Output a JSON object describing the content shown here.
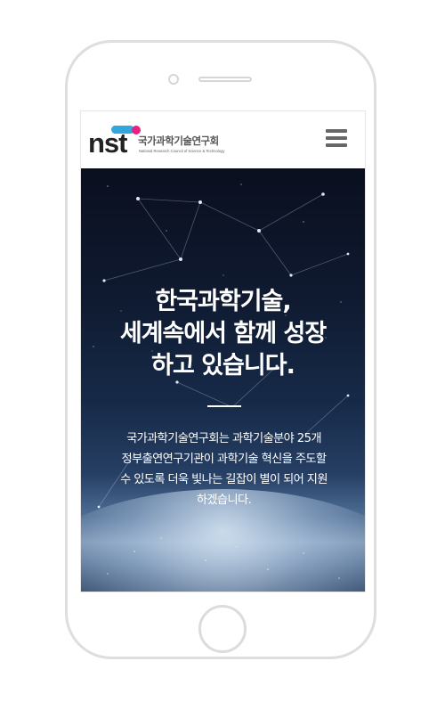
{
  "header": {
    "logo_mark": "nst",
    "logo_name": "국가과학기술연구회",
    "logo_subtitle": "National Research Council of Science & Technology",
    "menu_icon": "hamburger-menu-icon"
  },
  "hero": {
    "title_lines": [
      "한국과학기술,",
      "세계속에서 함께 성장",
      "하고 있습니다."
    ],
    "description_lines": [
      "국가과학기술연구회는 과학기술분야 25개",
      "정부출연연구기관이 과학기술 혁신을 주도할",
      "수 있도록 더욱 빛나는 길잡이 별이 되어 지원",
      "하겠습니다."
    ]
  },
  "device": {
    "frame_color": "#dedede",
    "logo_colors": {
      "pill": "#2fa8e0",
      "dot": "#e6217f",
      "text": "#222222"
    }
  }
}
